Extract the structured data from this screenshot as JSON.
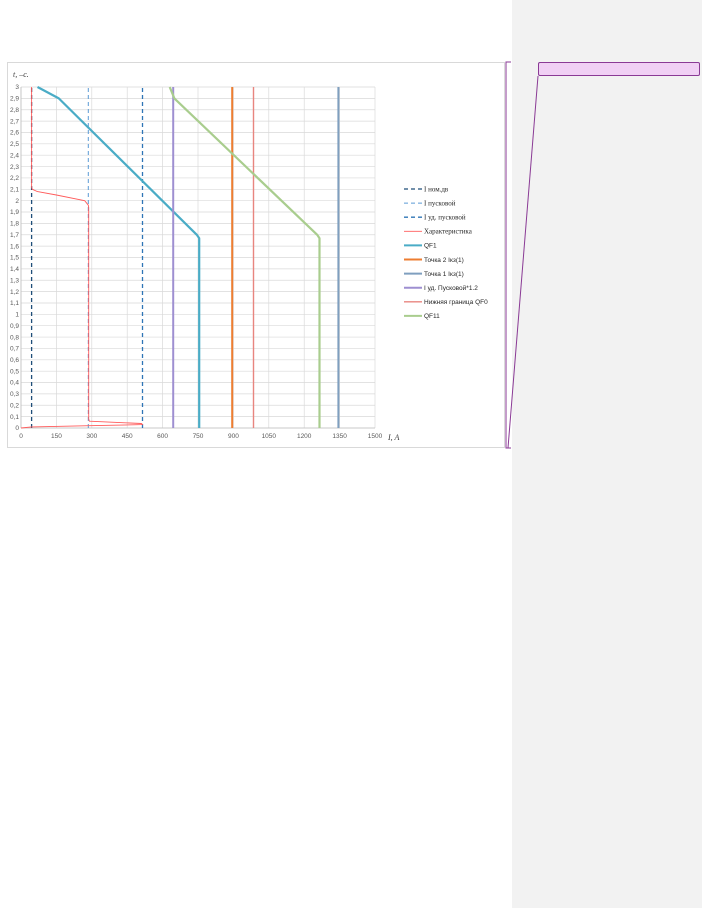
{
  "chart_data": {
    "type": "line",
    "xlabel": "I, A",
    "ylabel": "t, –c.",
    "xlim": [
      0,
      1500
    ],
    "ylim": [
      0,
      3
    ],
    "x_ticks": [
      "0",
      "150",
      "300",
      "450",
      "600",
      "750",
      "900",
      "1050",
      "1200",
      "1350",
      "1500"
    ],
    "y_ticks": [
      "0",
      "0,1",
      "0,2",
      "0,3",
      "0,4",
      "0,5",
      "0,6",
      "0,7",
      "0,8",
      "0,9",
      "1",
      "1,1",
      "1,2",
      "1,3",
      "1,4",
      "1,5",
      "1,6",
      "1,7",
      "1,8",
      "1,9",
      "2",
      "2,1",
      "2,2",
      "2,3",
      "2,4",
      "2,5",
      "2,6",
      "2,7",
      "2,8",
      "2,9",
      "3"
    ],
    "grid": true,
    "legend_position": "right",
    "series": [
      {
        "name": "I ном.дв",
        "color": "#1f4e79",
        "dash": "4,3",
        "width": 1.3,
        "points": [
          [
            45,
            0
          ],
          [
            45,
            3
          ]
        ]
      },
      {
        "name": "I пусковой",
        "color": "#5b9bd5",
        "dash": "4,3",
        "width": 1,
        "points": [
          [
            285,
            0
          ],
          [
            285,
            3
          ]
        ]
      },
      {
        "name": "I уд. пусковой",
        "color": "#2e75b6",
        "dash": "4,3",
        "width": 1.3,
        "points": [
          [
            515,
            0
          ],
          [
            515,
            3
          ]
        ]
      },
      {
        "name": "Характеристика",
        "color": "#ff5b5b",
        "dash": "",
        "width": 0.9,
        "points": [
          [
            0,
            0.0
          ],
          [
            45,
            0.01
          ],
          [
            290,
            0.02
          ],
          [
            515,
            0.03
          ],
          [
            510,
            0.04
          ],
          [
            290,
            0.06
          ],
          [
            287,
            0.08
          ],
          [
            287,
            1.94
          ],
          [
            285,
            1.96
          ],
          [
            270,
            2.0
          ],
          [
            150,
            2.05
          ],
          [
            70,
            2.08
          ],
          [
            48,
            2.1
          ],
          [
            45,
            2.12
          ],
          [
            45,
            3
          ]
        ]
      },
      {
        "name": "QF1",
        "color": "#4aacc6",
        "dash": "",
        "width": 2.2,
        "points": [
          [
            755,
            0
          ],
          [
            755,
            1.67
          ],
          [
            745,
            1.7
          ],
          [
            160,
            2.9
          ],
          [
            70,
            3.0
          ]
        ]
      },
      {
        "name": "Точка 2 Iкз(1)",
        "color": "#ed7d31",
        "dash": "",
        "width": 2,
        "points": [
          [
            895,
            0
          ],
          [
            895,
            3
          ]
        ]
      },
      {
        "name": "Точка 1 Iкз(1)",
        "color": "#7f9fbf",
        "dash": "",
        "width": 2,
        "points": [
          [
            1345,
            0
          ],
          [
            1345,
            3
          ]
        ]
      },
      {
        "name": "I уд. Пусковой*1.2",
        "color": "#9e8fd1",
        "dash": "",
        "width": 2,
        "points": [
          [
            645,
            0
          ],
          [
            645,
            3
          ]
        ]
      },
      {
        "name": "Нижняя граница QF0",
        "color": "#e8857f",
        "dash": "",
        "width": 1.4,
        "points": [
          [
            985,
            0
          ],
          [
            985,
            3
          ]
        ]
      },
      {
        "name": "QF11",
        "color": "#a9cd8e",
        "dash": "",
        "width": 2.2,
        "points": [
          [
            1265,
            0
          ],
          [
            1265,
            1.67
          ],
          [
            1255,
            1.7
          ],
          [
            650,
            2.9
          ],
          [
            630,
            3.0
          ]
        ]
      }
    ]
  }
}
